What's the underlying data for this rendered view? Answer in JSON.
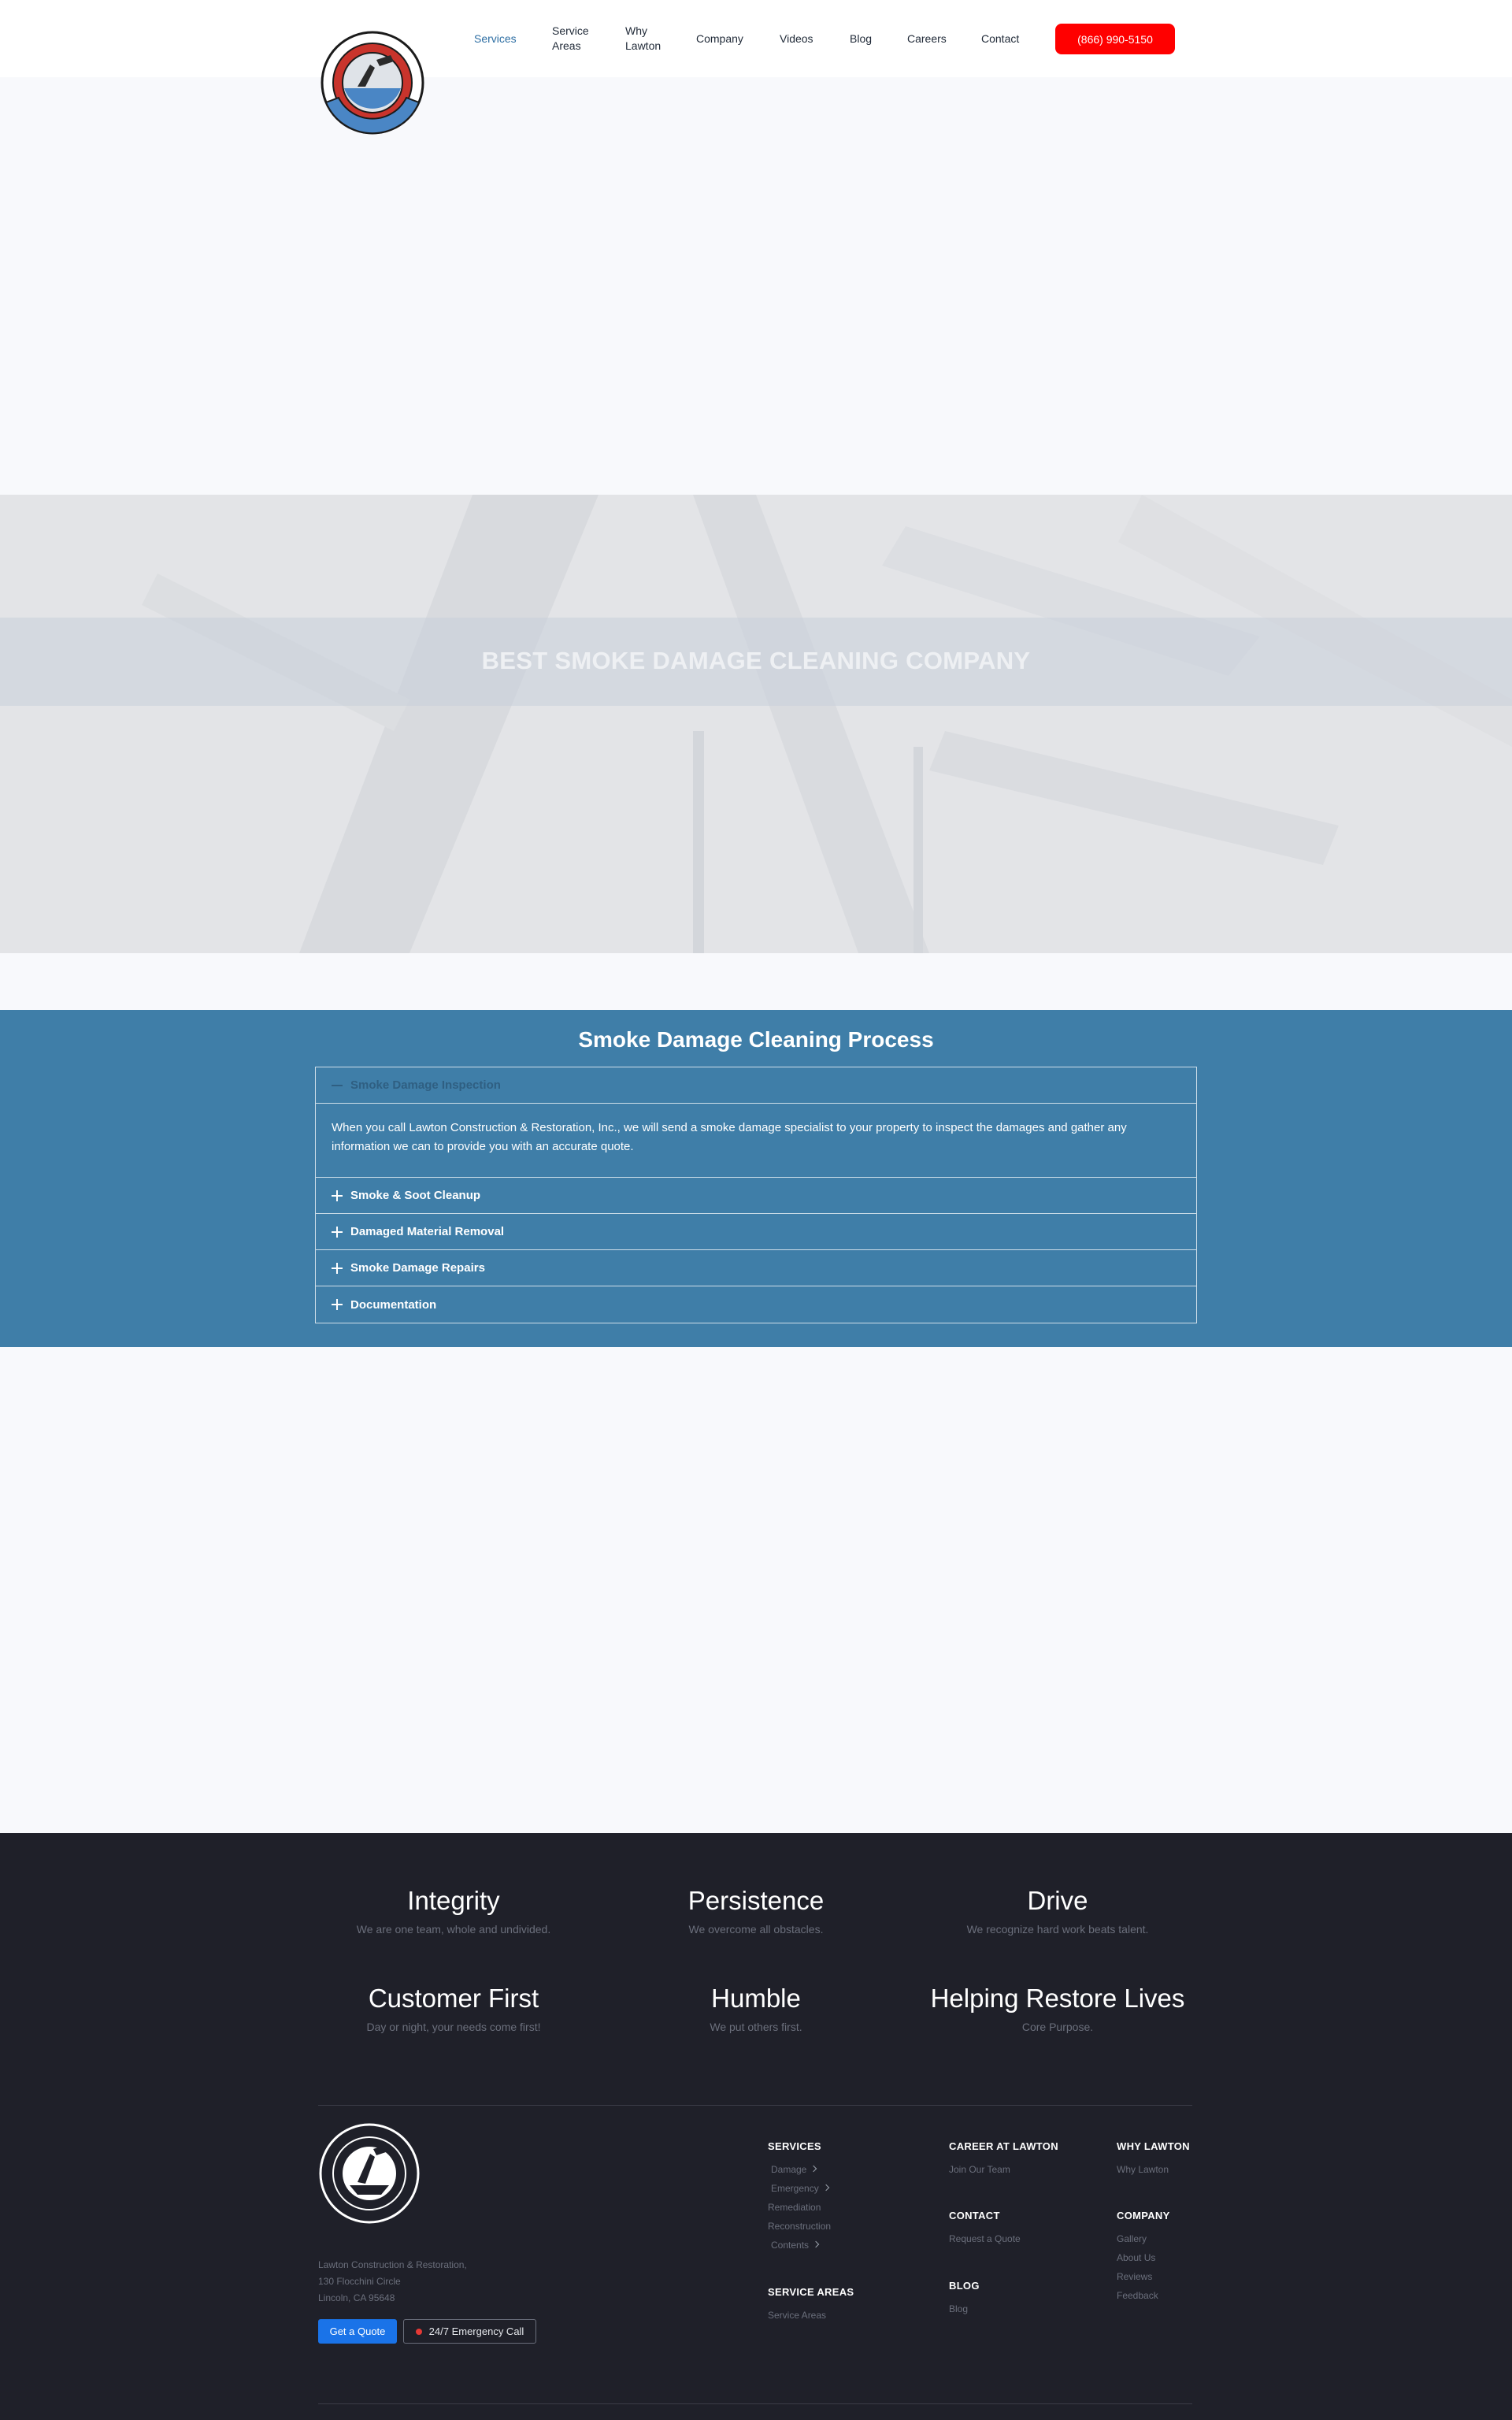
{
  "header": {
    "logo_name": "Lawton Construction & Restoration logo",
    "nav": [
      {
        "label": "Services",
        "active": true
      },
      {
        "label": "Service Areas"
      },
      {
        "label": "Why Lawton"
      },
      {
        "label": "Company"
      },
      {
        "label": "Videos"
      },
      {
        "label": "Blog"
      },
      {
        "label": "Careers"
      },
      {
        "label": "Contact"
      }
    ],
    "phone": "(866) 990-5150",
    "phone_color": "#ff0000",
    "active_color": "#2d6ea3"
  },
  "hero": {
    "title": "BEST SMOKE DAMAGE CLEANING COMPANY"
  },
  "process": {
    "title": "Smoke Damage Cleaning Process",
    "bg_color": "#3f7ea8",
    "items": [
      {
        "label": "Smoke Damage Inspection",
        "open": true,
        "body": "When you call Lawton Construction & Restoration, Inc., we will send a smoke damage specialist to your property to inspect the damages and gather any information we can to provide you with an accurate quote."
      },
      {
        "label": "Smoke & Soot Cleanup",
        "open": false
      },
      {
        "label": "Damaged Material Removal",
        "open": false
      },
      {
        "label": "Smoke Damage Repairs",
        "open": false
      },
      {
        "label": "Documentation",
        "open": false
      }
    ]
  },
  "footer": {
    "bg_color": "#1f2029",
    "values": [
      {
        "title": "Integrity",
        "subtitle": "We are one team, whole and undivided."
      },
      {
        "title": "Persistence",
        "subtitle": "We overcome all obstacles."
      },
      {
        "title": "Drive",
        "subtitle": "We recognize hard work beats talent."
      },
      {
        "title": "Customer First",
        "subtitle": "Day or night, your needs come first!"
      },
      {
        "title": "Humble",
        "subtitle": "We put others first."
      },
      {
        "title": "Helping Restore Lives",
        "subtitle": "Core Purpose."
      }
    ],
    "address": [
      "Lawton Construction & Restoration,",
      "130 Flocchini Circle",
      "Lincoln, CA 95648"
    ],
    "quote_button": "Get a Quote",
    "emergency_button": "24/7 Emergency Call",
    "columns": {
      "services": {
        "heading": "SERVICES",
        "links": [
          "Damage",
          "Emergency",
          "Remediation",
          "Reconstruction",
          "Contents"
        ]
      },
      "service_areas": {
        "heading": "SERVICE AREAS",
        "links": [
          "Service Areas"
        ]
      },
      "career": {
        "heading": "CAREER AT LAWTON",
        "links": [
          "Join Our Team"
        ]
      },
      "contact": {
        "heading": "CONTACT",
        "links": [
          "Request a Quote"
        ]
      },
      "blog": {
        "heading": "BLOG",
        "links": [
          "Blog"
        ]
      },
      "why": {
        "heading": "WHY LAWTON",
        "links": [
          "Why Lawton"
        ]
      },
      "company": {
        "heading": "COMPANY",
        "links": [
          "Gallery",
          "About Us",
          "Reviews",
          "Feedback"
        ]
      }
    }
  }
}
